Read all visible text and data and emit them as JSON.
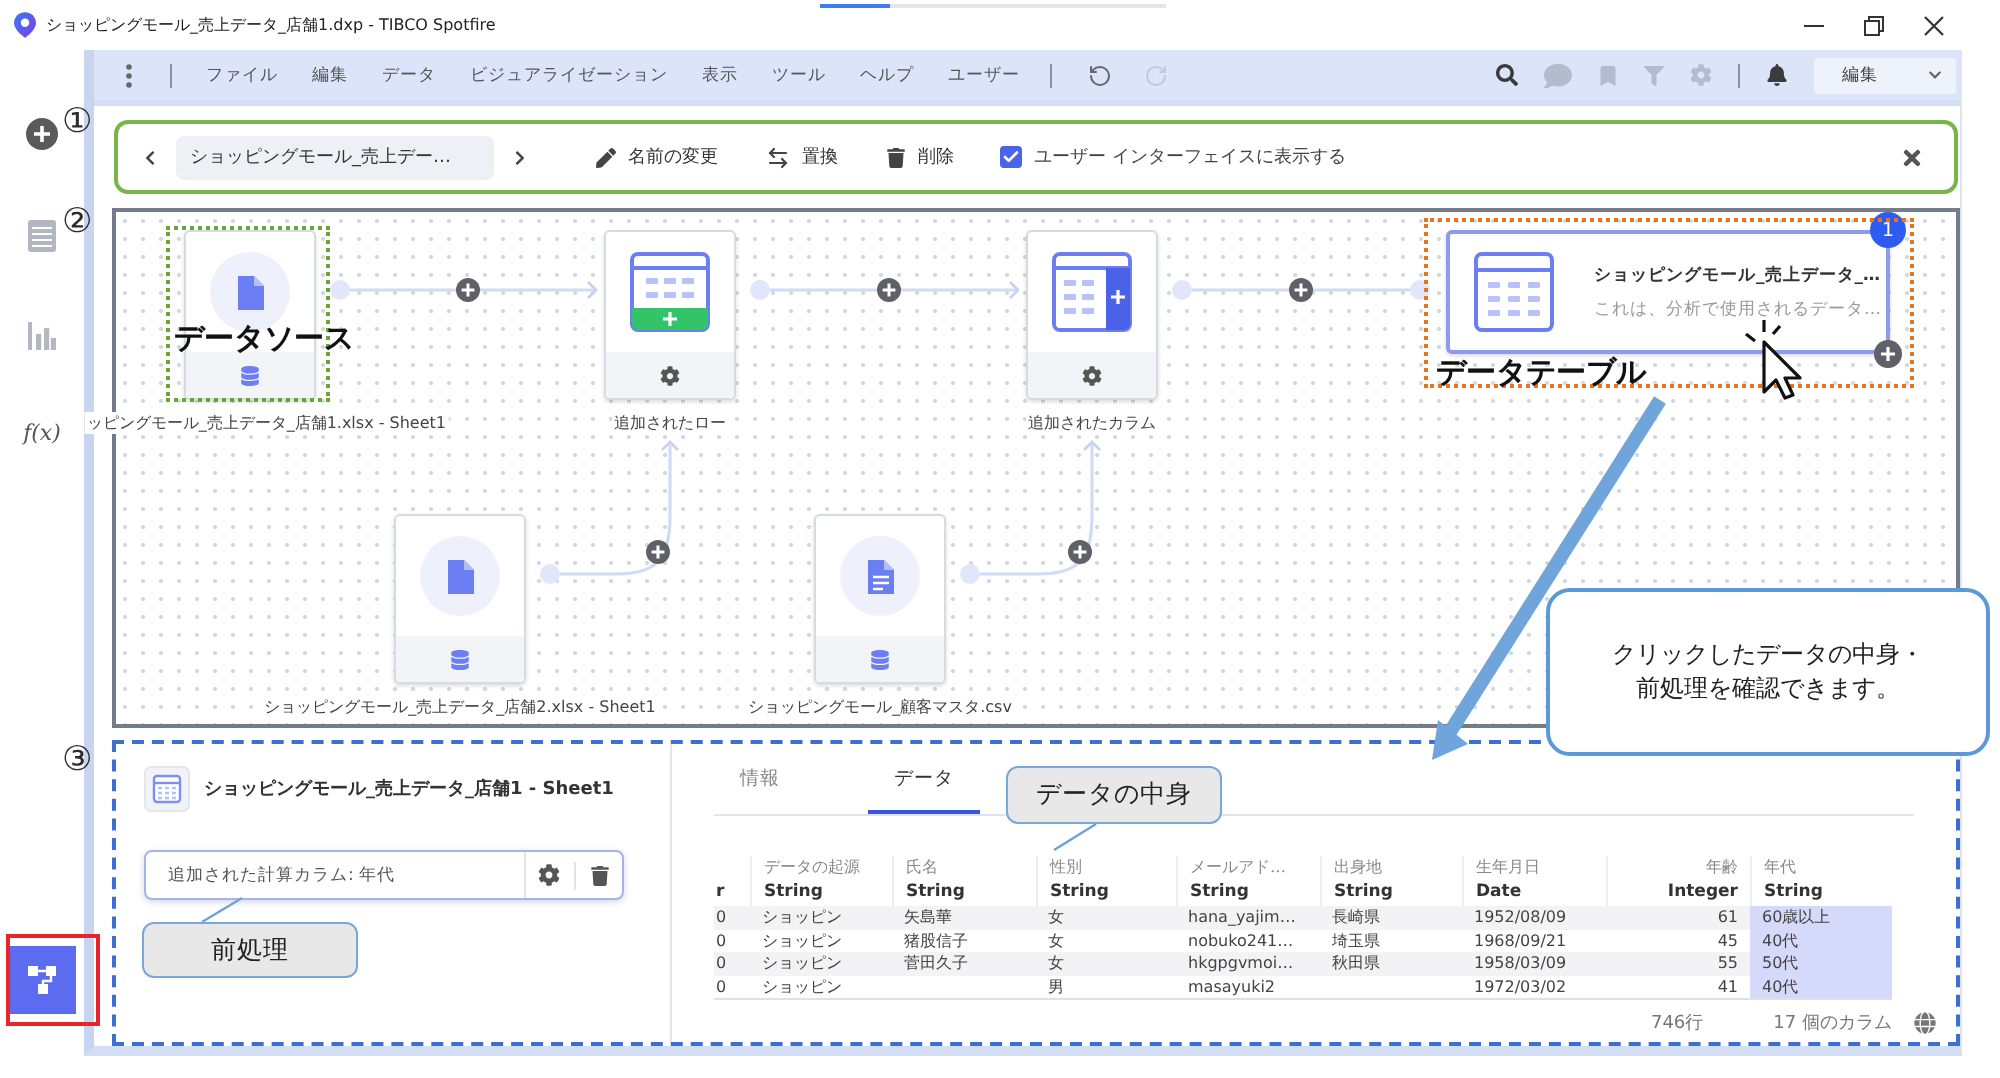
{
  "window": {
    "title": "ショッピングモール_売上データ_店舗1.dxp - TIBCO Spotfire",
    "progress": {
      "level": 0.2
    }
  },
  "menu_bar": {
    "items": [
      "ファイル",
      "編集",
      "データ",
      "ビジュアライゼーション",
      "表示",
      "ツール",
      "ヘルプ",
      "ユーザー"
    ],
    "history": [
      {
        "kind": "undo",
        "disabled": false
      },
      {
        "kind": "redo",
        "disabled": true
      }
    ],
    "tools": [
      {
        "kind": "search",
        "disabled": false
      },
      {
        "kind": "comment",
        "disabled": true
      },
      {
        "kind": "bookmark",
        "disabled": true
      },
      {
        "kind": "filter",
        "disabled": true
      },
      {
        "kind": "settings",
        "disabled": true
      },
      {
        "kind": "notifications",
        "disabled": false
      }
    ],
    "mode": "編集"
  },
  "sidebar": {
    "items": [
      {
        "kind": "add",
        "selected": false
      },
      {
        "kind": "table",
        "selected": false
      },
      {
        "kind": "chart",
        "selected": false
      },
      {
        "kind": "formula",
        "label": "f(x)",
        "selected": false
      },
      {
        "kind": "flow",
        "selected": true
      }
    ]
  },
  "data_canvas_bar": {
    "table_name": "ショッピングモール_売上デー…",
    "actions": [
      {
        "kind": "rename",
        "label": "名前の変更"
      },
      {
        "kind": "replace",
        "label": "置換"
      },
      {
        "kind": "delete",
        "label": "削除"
      }
    ],
    "show_in_ui": {
      "label": "ユーザー インターフェイスに表示する",
      "checked": true
    }
  },
  "canvas": {
    "nodes": [
      {
        "kind": "file",
        "label": "ッピングモール_売上データ_店舗1.xlsx - Sheet1",
        "selected": false
      },
      {
        "kind": "add_rows",
        "label": "追加されたロー",
        "selected": false
      },
      {
        "kind": "add_columns",
        "label": "追加されたカラム",
        "selected": false
      },
      {
        "kind": "table",
        "title": "ショッピングモール_売上データ_…",
        "description": "これは、分析で使用されるデータ…",
        "badge": "1",
        "selected": true
      },
      {
        "kind": "file",
        "label": "ショッピングモール_売上データ_店舗2.xlsx - Sheet1",
        "selected": false
      },
      {
        "kind": "text_file",
        "label": "ショッピングモール_顧客マスタ.csv",
        "selected": false
      }
    ]
  },
  "details_panel": {
    "title": "ショッピングモール_売上データ_店舗1 - Sheet1",
    "steps": [
      {
        "label": "追加された計算カラム: 年代"
      }
    ],
    "tabs": [
      {
        "label": "情報",
        "selected": false
      },
      {
        "label": "データ",
        "selected": true
      }
    ],
    "table": {
      "columns": [
        {
          "type": "r",
          "kind": "text",
          "highlighted": false
        },
        {
          "name": "データの起源",
          "type": "String",
          "kind": "text",
          "highlighted": false
        },
        {
          "name": "氏名",
          "type": "String",
          "kind": "text",
          "highlighted": false
        },
        {
          "name": "性別",
          "type": "String",
          "kind": "text",
          "highlighted": false
        },
        {
          "name": "メールアド…",
          "type": "String",
          "kind": "text",
          "highlighted": false
        },
        {
          "name": "出身地",
          "type": "String",
          "kind": "text",
          "highlighted": false
        },
        {
          "name": "生年月日",
          "type": "Date",
          "kind": "text",
          "highlighted": false
        },
        {
          "name": "年齢",
          "type": "Integer",
          "kind": "number",
          "highlighted": false
        },
        {
          "name": "年代",
          "type": "String",
          "kind": "text",
          "highlighted": true
        }
      ],
      "rows": [
        [
          "0",
          "ショッピン",
          "矢島華",
          "女",
          "hana_yajim…",
          "長崎県",
          "1952/08/09",
          "61",
          "60歳以上"
        ],
        [
          "0",
          "ショッピン",
          "猪股信子",
          "女",
          "nobuko241…",
          "埼玉県",
          "1968/09/21",
          "45",
          "40代"
        ],
        [
          "0",
          "ショッピン",
          "菅田久子",
          "女",
          "hkgpgvmoi…",
          "秋田県",
          "1958/03/09",
          "55",
          "50代"
        ],
        [
          "0",
          "ショッピン",
          null,
          "男",
          "masayuki2",
          null,
          "1972/03/02",
          "41",
          "40代"
        ]
      ]
    },
    "row_count": "746行",
    "column_count": "17 個のカラム"
  },
  "annotations": {
    "step_markers": [
      "①",
      "②",
      "③"
    ],
    "highlight_labels": [
      "データソース",
      "データテーブル"
    ],
    "callouts": [
      {
        "kind": "note",
        "lines": [
          "クリックしたデータの中身・",
          "前処理を確認できます。"
        ]
      },
      {
        "kind": "tag",
        "lines": [
          "データの中身"
        ]
      },
      {
        "kind": "tag",
        "lines": [
          "前処理"
        ]
      }
    ]
  }
}
